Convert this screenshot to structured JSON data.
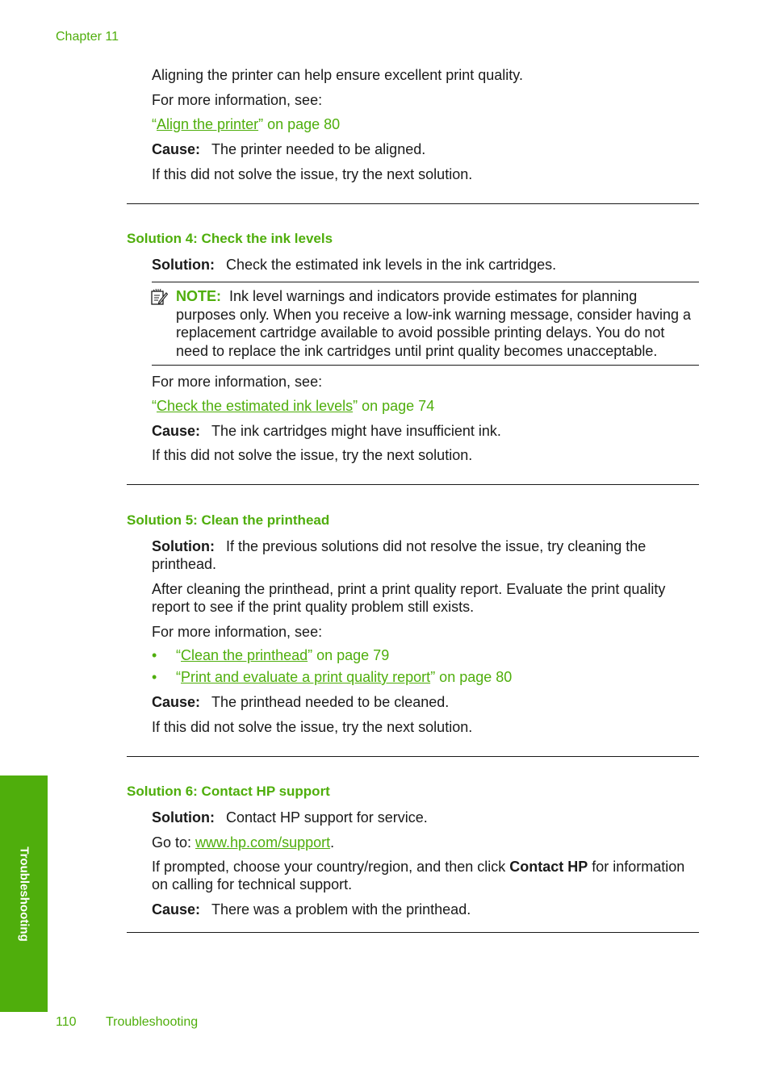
{
  "header": {
    "chapter": "Chapter 11"
  },
  "intro": {
    "p1": "Aligning the printer can help ensure excellent print quality.",
    "more_info": "For more information, see:",
    "link": {
      "open_quote": "“",
      "text": "Align the printer",
      "suffix": "” on page 80"
    },
    "cause_label": "Cause:",
    "cause_text": "The printer needed to be aligned.",
    "next": "If this did not solve the issue, try the next solution."
  },
  "solution4": {
    "heading": "Solution 4: Check the ink levels",
    "solution_label": "Solution:",
    "solution_text": "Check the estimated ink levels in the ink cartridges.",
    "note": {
      "icon": "note-pencil-icon",
      "label": "NOTE:",
      "text": "Ink level warnings and indicators provide estimates for planning purposes only. When you receive a low-ink warning message, consider having a replacement cartridge available to avoid possible printing delays. You do not need to replace the ink cartridges until print quality becomes unacceptable."
    },
    "more_info": "For more information, see:",
    "link": {
      "open_quote": "“",
      "text": "Check the estimated ink levels",
      "suffix": "” on page 74"
    },
    "cause_label": "Cause:",
    "cause_text": "The ink cartridges might have insufficient ink.",
    "next": "If this did not solve the issue, try the next solution."
  },
  "solution5": {
    "heading": "Solution 5: Clean the printhead",
    "solution_label": "Solution:",
    "solution_text": "If the previous solutions did not resolve the issue, try cleaning the printhead.",
    "p2": "After cleaning the printhead, print a print quality report. Evaluate the print quality report to see if the print quality problem still exists.",
    "more_info": "For more information, see:",
    "links": [
      {
        "bullet": "•",
        "open_quote": "“",
        "text": "Clean the printhead",
        "suffix": "” on page 79"
      },
      {
        "bullet": "•",
        "open_quote": "“",
        "text": "Print and evaluate a print quality report",
        "suffix": "” on page 80"
      }
    ],
    "cause_label": "Cause:",
    "cause_text": "The printhead needed to be cleaned.",
    "next": "If this did not solve the issue, try the next solution."
  },
  "solution6": {
    "heading": "Solution 6: Contact HP support",
    "solution_label": "Solution:",
    "solution_text": "Contact HP support for service.",
    "goto_prefix": "Go to: ",
    "goto_link": "www.hp.com/support",
    "goto_suffix": ".",
    "prompt_pre": "If prompted, choose your country/region, and then click ",
    "prompt_bold": "Contact HP",
    "prompt_post": " for information on calling for technical support.",
    "cause_label": "Cause:",
    "cause_text": "There was a problem with the printhead."
  },
  "sidetab": {
    "label": "Troubleshooting"
  },
  "footer": {
    "page_number": "110",
    "section": "Troubleshooting"
  },
  "colors": {
    "accent": "#4fae0c",
    "text": "#1a1a1a"
  }
}
